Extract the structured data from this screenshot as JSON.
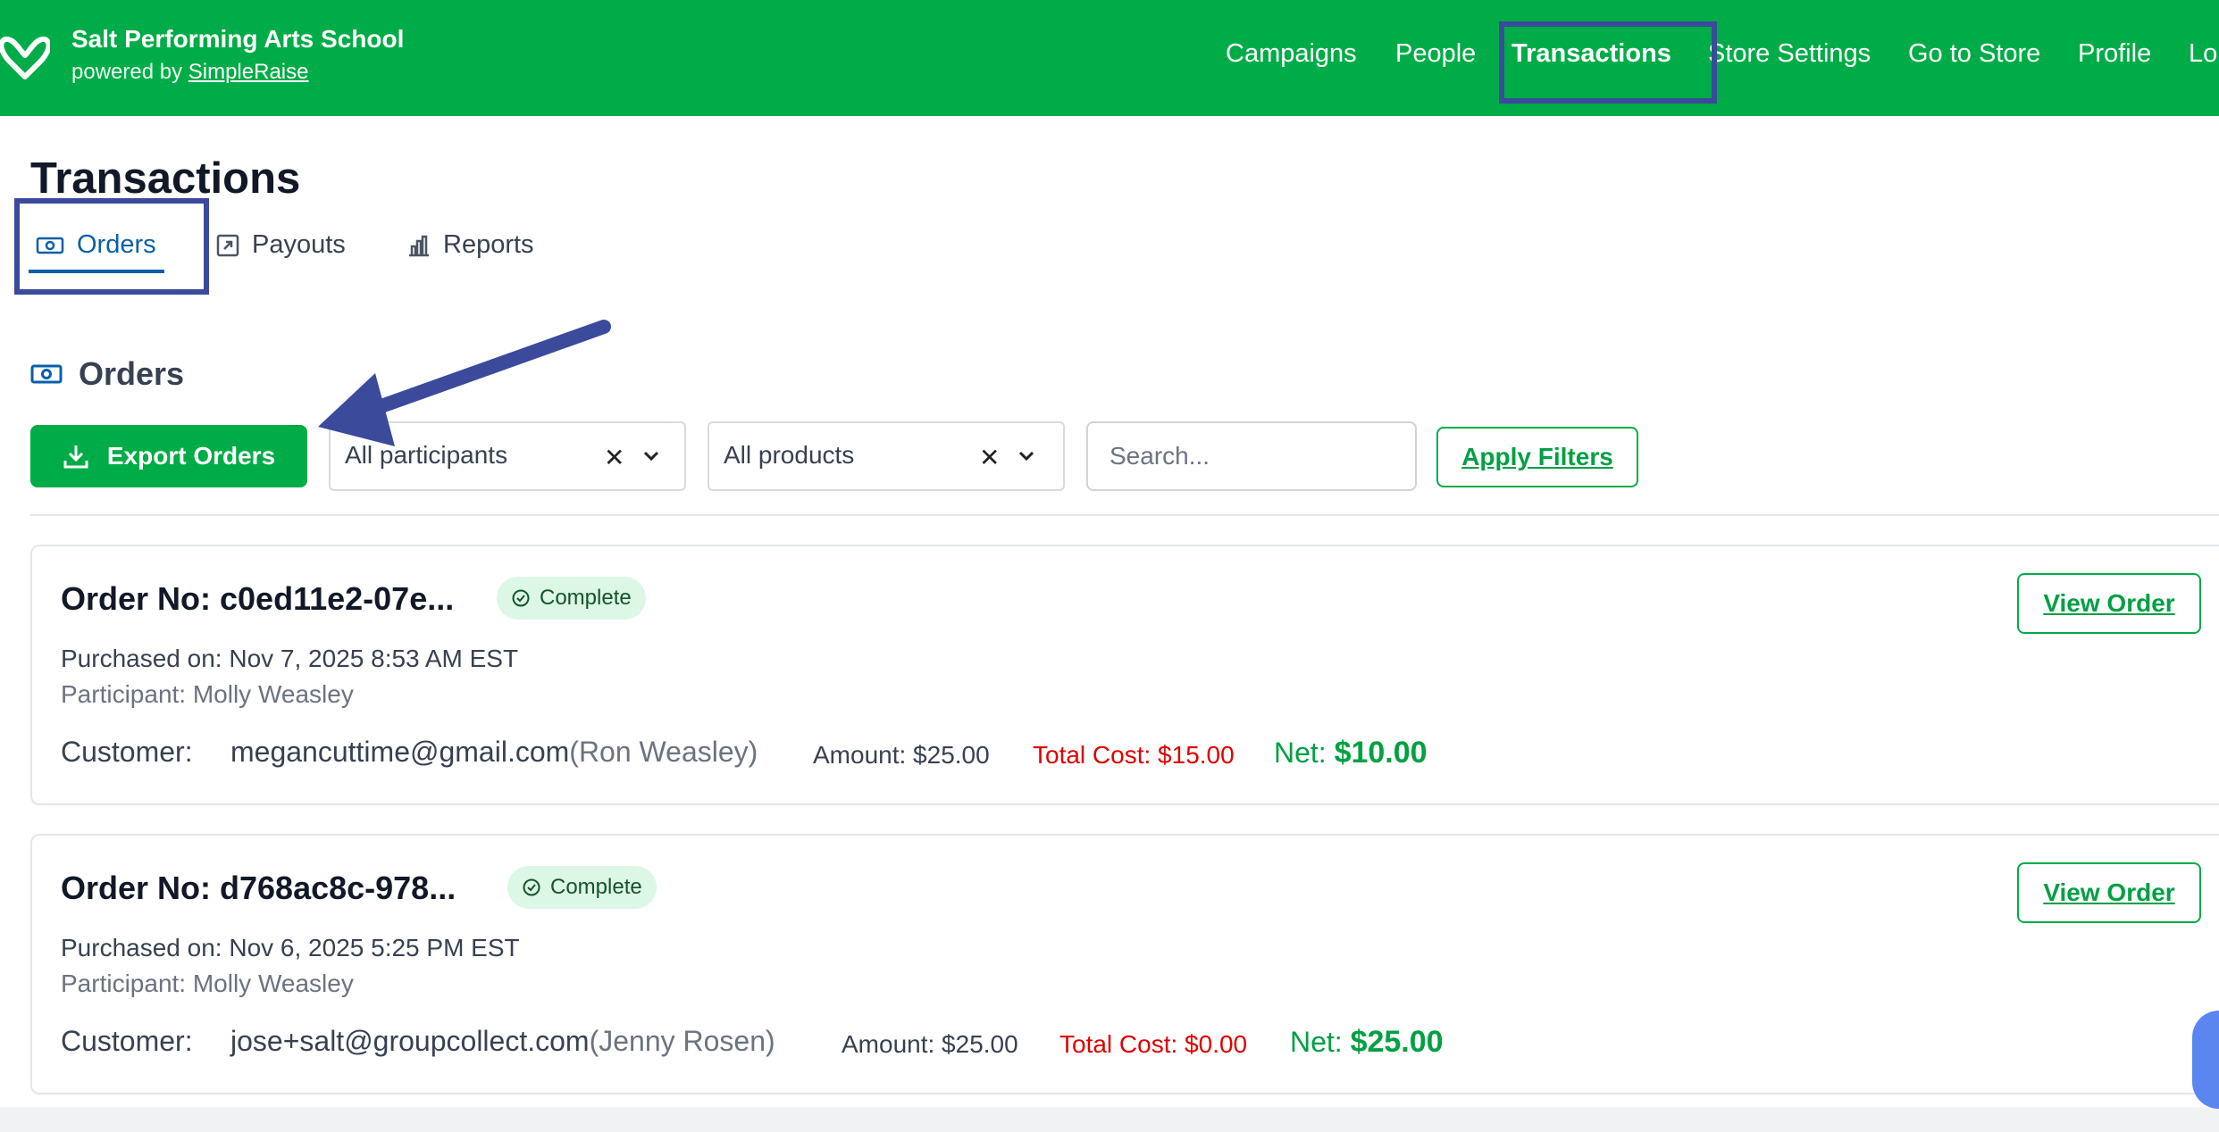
{
  "header": {
    "org_name": "Salt Performing Arts School",
    "powered_prefix": "powered by ",
    "powered_link": "SimpleRaise",
    "nav": [
      "Campaigns",
      "People",
      "Transactions",
      "Store Settings",
      "Go to Store",
      "Profile",
      "Lo"
    ],
    "active_nav": "Transactions",
    "brand_color": "#00ac47"
  },
  "page": {
    "title": "Transactions",
    "tabs": [
      {
        "label": "Orders",
        "icon": "money-icon",
        "active": true
      },
      {
        "label": "Payouts",
        "icon": "external-link-icon",
        "active": false
      },
      {
        "label": "Reports",
        "icon": "bar-chart-icon",
        "active": false
      }
    ]
  },
  "orders_section": {
    "title": "Orders",
    "export_label": "Export Orders",
    "participants_filter": "All participants",
    "products_filter": "All products",
    "search_placeholder": "Search...",
    "apply_label": "Apply Filters"
  },
  "orders": [
    {
      "order_no": "Order No: c0ed11e2-07e...",
      "status": "Complete",
      "purchased": "Purchased on: Nov 7, 2025 8:53 AM EST",
      "participant": "Participant: Molly Weasley",
      "customer_label": "Customer:",
      "customer_email": "megancuttime@gmail.com",
      "customer_name": "(Ron Weasley)",
      "amount": "Amount: $25.00",
      "total_cost": "Total Cost: $15.00",
      "net_label": "Net: ",
      "net_value": "$10.00",
      "view_label": "View Order"
    },
    {
      "order_no": "Order No: d768ac8c-978...",
      "status": "Complete",
      "purchased": "Purchased on: Nov 6, 2025 5:25 PM EST",
      "participant": "Participant: Molly Weasley",
      "customer_label": "Customer:",
      "customer_email": "jose+salt@groupcollect.com",
      "customer_name": "(Jenny Rosen)",
      "amount": "Amount: $25.00",
      "total_cost": "Total Cost: $0.00",
      "net_label": "Net: ",
      "net_value": "$25.00",
      "view_label": "View Order"
    }
  ]
}
